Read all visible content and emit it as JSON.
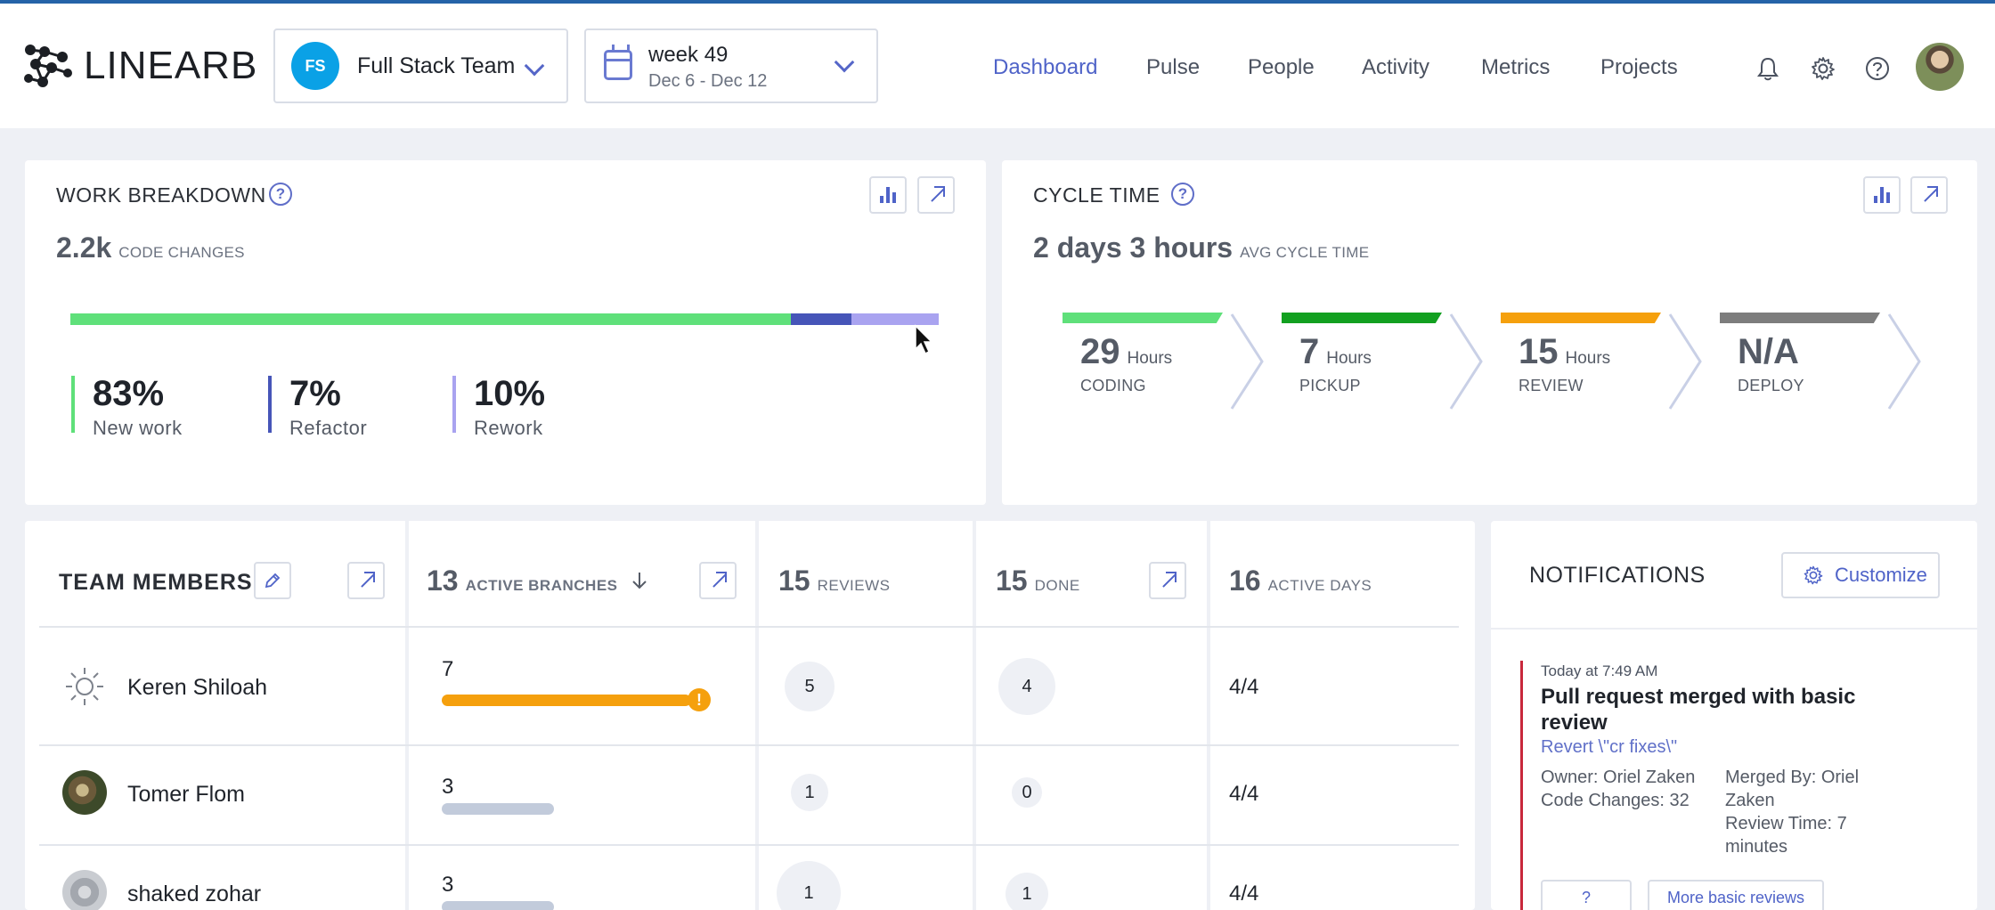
{
  "header": {
    "logo": "LINEARB",
    "team": {
      "initials": "FS",
      "name": "Full Stack Team"
    },
    "week": {
      "title": "week 49",
      "range": "Dec 6 - Dec 12"
    },
    "nav": [
      "Dashboard",
      "Pulse",
      "People",
      "Activity",
      "Metrics",
      "Projects"
    ],
    "active_nav": "Dashboard",
    "icons": [
      "bell-icon",
      "gear-icon",
      "help-icon",
      "avatar"
    ]
  },
  "work_breakdown": {
    "title": "WORK BREAKDOWN",
    "total": "2.2k",
    "total_label": "CODE CHANGES",
    "segments": [
      {
        "name": "New work",
        "value": "83%",
        "fraction": 0.83,
        "color": "#5fe07a"
      },
      {
        "name": "Refactor",
        "value": "7%",
        "fraction": 0.07,
        "color": "#4655b8"
      },
      {
        "name": "Rework",
        "value": "10%",
        "fraction": 0.1,
        "color": "#a9a3f0"
      }
    ]
  },
  "cycle_time": {
    "title": "CYCLE TIME",
    "avg": "2 days 3 hours",
    "avg_label": "AVG CYCLE TIME",
    "stages": [
      {
        "value": "29",
        "unit": "Hours",
        "label": "CODING",
        "color": "#5fe07a"
      },
      {
        "value": "7",
        "unit": "Hours",
        "label": "PICKUP",
        "color": "#12a020"
      },
      {
        "value": "15",
        "unit": "Hours",
        "label": "REVIEW",
        "color": "#f5a00d"
      },
      {
        "value": "N/A",
        "unit": "",
        "label": "DEPLOY",
        "color": "#7d7d7d"
      }
    ]
  },
  "team_members": {
    "title": "TEAM MEMBERS",
    "columns": {
      "branches": {
        "value": "13",
        "label": "ACTIVE BRANCHES"
      },
      "reviews": {
        "value": "15",
        "label": "REVIEWS"
      },
      "done": {
        "value": "15",
        "label": "DONE"
      },
      "active_days": {
        "value": "16",
        "label": "ACTIVE DAYS"
      }
    },
    "rows": [
      {
        "name": "Keren Shiloah",
        "branches": "7",
        "branch_fraction": 1.0,
        "branch_warning": "!",
        "reviews": "5",
        "done": "4",
        "days": "4/4"
      },
      {
        "name": "Tomer Flom",
        "branches": "3",
        "branch_fraction": 0.45,
        "reviews": "1",
        "done": "0",
        "days": "4/4"
      },
      {
        "name": "shaked zohar",
        "branches": "3",
        "branch_fraction": 0.45,
        "reviews": "1",
        "done": "1",
        "days": "4/4"
      }
    ],
    "colors": {
      "warn_bar": "#f5a00d",
      "normal_bar": "#c2cbdb"
    }
  },
  "notifications": {
    "title": "NOTIFICATIONS",
    "customize": "Customize",
    "item": {
      "time": "Today at 7:49 AM",
      "title": "Pull request merged with basic review",
      "link": "Revert \\\"cr fixes\\\"",
      "owner": "Owner: Oriel Zaken",
      "code_changes": "Code Changes: 32",
      "merged_by": "Merged By: Oriel Zaken",
      "review_time": "Review Time: 7 minutes",
      "btn_help": "?",
      "btn_more": "More basic reviews"
    }
  }
}
